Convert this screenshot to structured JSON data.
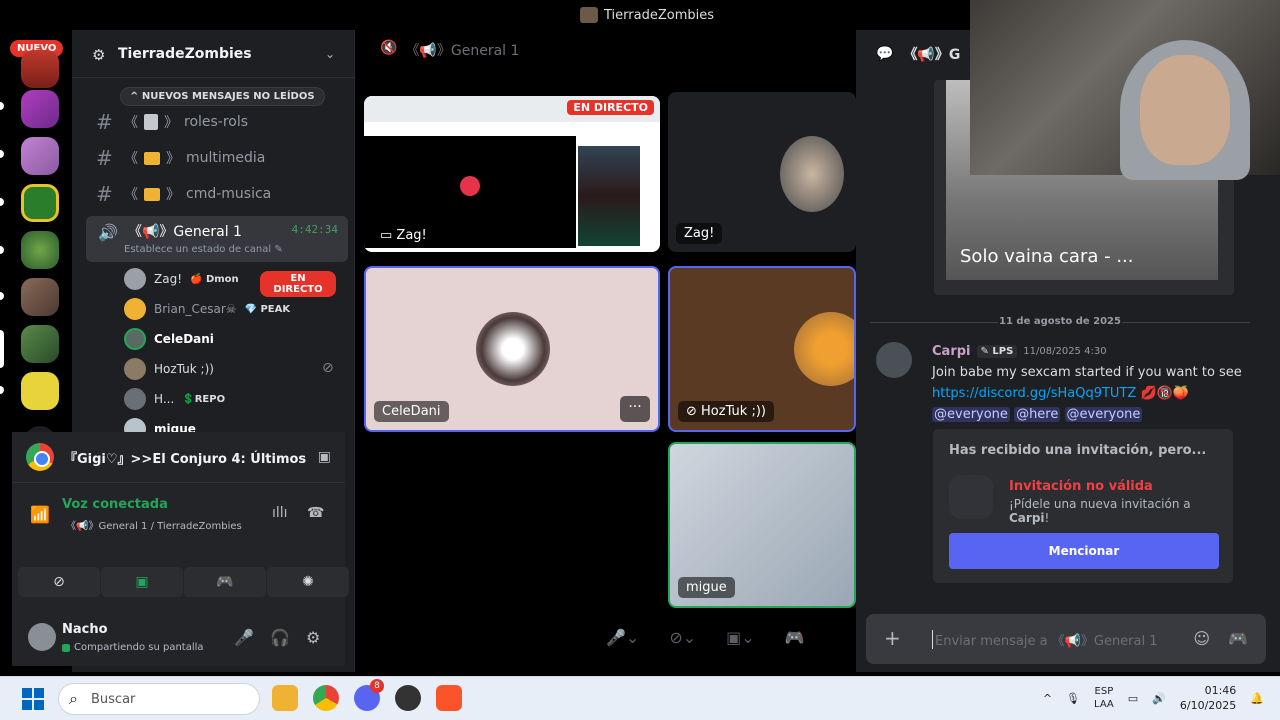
{
  "window": {
    "title": "TierradeZombies"
  },
  "rail": {
    "new_badge": "NUEVO"
  },
  "sidebar": {
    "server_name": "TierradeZombies",
    "unread_pill": "NUEVOS MENSAJES NO LEÍDOS",
    "channels": [
      {
        "prefix": "《",
        "suffix": "》",
        "name": "roles-rols",
        "icon": "doc-icon"
      },
      {
        "prefix": "《",
        "suffix": "》",
        "name": "multimedia",
        "icon": "folder-icon"
      },
      {
        "prefix": "《",
        "suffix": "》",
        "name": "cmd-musica",
        "icon": "folder-icon"
      }
    ],
    "voice_channel": {
      "name": "《📢》General 1",
      "timer": "4:42:34",
      "status": "Establece un estado de canal"
    },
    "members": [
      {
        "name": "Zag!",
        "tag": "🍎 Dmon",
        "live": "EN DIRECTO",
        "color": "#9aa0a6"
      },
      {
        "name": "Brian_Cesar☠",
        "tag": "💎 PEAK",
        "live": "",
        "color": "#f0b232"
      },
      {
        "name": "CeleDani",
        "tag": "",
        "live": "",
        "color": "#5a6a62"
      },
      {
        "name": "HozTuk ;))",
        "tag": "",
        "live": "",
        "color": "#8a7a66"
      },
      {
        "name": "H...",
        "tag": "💲REPO",
        "live": "",
        "color": "#6a6e76"
      },
      {
        "name": "migue",
        "tag": "",
        "live": "",
        "color": "#b9c3cc"
      }
    ]
  },
  "activity": {
    "title": "『Gigi♡』>>El Conjuro 4: Últimos ..."
  },
  "voice_panel": {
    "status": "Voz conectada",
    "location": "《📢》General 1 / TierradeZombies"
  },
  "user": {
    "name": "Nacho",
    "status": "Compartiendo su pantalla"
  },
  "stage": {
    "header": "《📢》General 1",
    "tiles": [
      {
        "label": "Zag!",
        "live": "EN DIRECTO"
      },
      {
        "label": "Zag!"
      },
      {
        "label": "CeleDani"
      },
      {
        "label": "HozTuk ;))"
      },
      {
        "label": "migue"
      }
    ]
  },
  "chat": {
    "header": "《📢》G",
    "embed_caption": "Solo vaina cara - ...",
    "date_separator": "11 de agosto de 2025",
    "message": {
      "author": "Carpi",
      "badge": "LPS",
      "time": "11/08/2025 4:30",
      "text": "Join babe my sexcam started if you want to see",
      "link": "https://discord.gg/sHaQq9TUTZ",
      "emoji": "💋🔞🍑",
      "mentions": [
        "@everyone",
        "@here",
        "@everyone"
      ]
    },
    "invite": {
      "title": "Has recibido una invitación, pero...",
      "invalid": "Invitación no válida",
      "sub_prefix": "¡Pídele una nueva invitación a ",
      "sub_user": "Carpi",
      "sub_suffix": "!",
      "button": "Mencionar"
    },
    "composer_placeholder": "Enviar mensaje a 《📢》General 1"
  },
  "taskbar": {
    "search_placeholder": "Buscar",
    "lang_top": "ESP",
    "lang_bottom": "LAA",
    "time": "01:46",
    "date": "6/10/2025",
    "discord_badge": "8"
  }
}
